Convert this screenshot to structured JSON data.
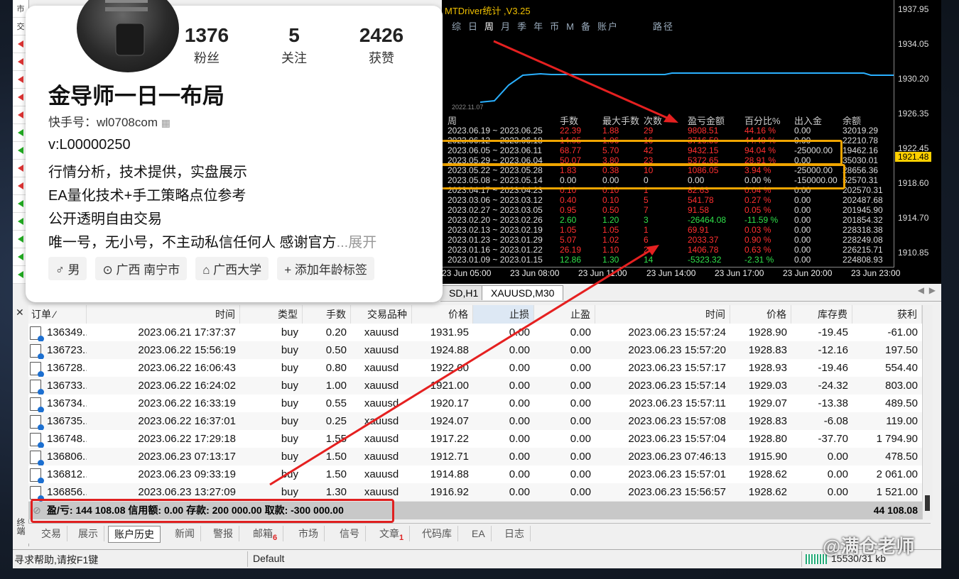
{
  "profile": {
    "followers": "1376",
    "followers_label": "粉丝",
    "following": "5",
    "following_label": "关注",
    "likes": "2426",
    "likes_label": "获赞",
    "name": "金导师一日一布局",
    "kuaishou_id": "快手号：wl0708com",
    "bio": [
      "v:L00000250",
      "行情分析，技术提供，实盘展示",
      "EA量化技术+手工策略点位参考",
      "公开透明自由交易"
    ],
    "bio_last": "唯一号，无小号，不主动私信任何人 感谢官方",
    "bio_more": "...展开",
    "tags": [
      "♂ 男",
      "⊙ 广西 南宁市",
      "⌂ 广西大学",
      "+ 添加年龄标签"
    ]
  },
  "left_strip": [
    "市",
    "交"
  ],
  "chart": {
    "title": "MTDriver统计 ,V3.25",
    "tabs": [
      "综",
      "日",
      "周",
      "月",
      "季",
      "年",
      "币",
      "M",
      "备",
      "账户",
      "路径"
    ],
    "active_tab": "周",
    "equity_date": "2022.11.07",
    "yticks": [
      "1937.95",
      "1934.05",
      "1930.20",
      "1926.35",
      "1922.45",
      "1918.60",
      "1914.70",
      "1910.85"
    ],
    "current_price": "1921.48",
    "xticks": [
      "23 Jun 05:00",
      "23 Jun 08:00",
      "23 Jun 11:00",
      "23 Jun 14:00",
      "23 Jun 17:00",
      "23 Jun 20:00",
      "23 Jun 23:00"
    ],
    "stat_headers": [
      "周",
      "手数",
      "最大手数",
      "次数",
      "盈亏金额",
      "百分比%",
      "出入金",
      "余额"
    ],
    "stat_rows": [
      [
        "2023.06.19 ~ 2023.06.25",
        "22.39",
        "1.88",
        "29",
        "9808.51",
        "44.16 %",
        "0.00",
        "32019.29",
        "r"
      ],
      [
        "2023.06.12 ~ 2023.06.18",
        "14.05",
        "1.06",
        "16",
        "3716.59",
        "44.49 %",
        "0.00",
        "22210.78",
        "r"
      ],
      [
        "2023.06.05 ~ 2023.06.11",
        "68.77",
        "5.70",
        "42",
        "9432.15",
        "94.04 %",
        "-25000.00",
        "19462.16",
        "r"
      ],
      [
        "2023.05.29 ~ 2023.06.04",
        "50.07",
        "3.80",
        "23",
        "5372.65",
        "28.91 %",
        "0.00",
        "35030.01",
        "r"
      ],
      [
        "2023.05.22 ~ 2023.05.28",
        "1.83",
        "0.38",
        "10",
        "1086.05",
        "3.94 %",
        "-25000.00",
        "28656.36",
        "r"
      ],
      [
        "2023.05.08 ~ 2023.05.14",
        "0.00",
        "0.00",
        "0",
        "0.00",
        "0.00 %",
        "-150000.00",
        "52570.31",
        "w"
      ],
      [
        "2023.04.17 ~ 2023.04.23",
        "0.10",
        "0.10",
        "1",
        "82.63",
        "0.04 %",
        "0.00",
        "202570.31",
        "r"
      ],
      [
        "2023.03.06 ~ 2023.03.12",
        "0.40",
        "0.10",
        "5",
        "541.78",
        "0.27 %",
        "0.00",
        "202487.68",
        "r"
      ],
      [
        "2023.02.27 ~ 2023.03.05",
        "0.95",
        "0.50",
        "7",
        "91.58",
        "0.05 %",
        "0.00",
        "201945.90",
        "r"
      ],
      [
        "2023.02.20 ~ 2023.02.26",
        "2.60",
        "1.20",
        "3",
        "-26464.08",
        "-11.59 %",
        "0.00",
        "201854.32",
        "g"
      ],
      [
        "2023.02.13 ~ 2023.02.19",
        "1.05",
        "1.05",
        "1",
        "69.91",
        "0.03 %",
        "0.00",
        "228318.38",
        "r"
      ],
      [
        "2023.01.23 ~ 2023.01.29",
        "5.07",
        "1.02",
        "6",
        "2033.37",
        "0.90 %",
        "0.00",
        "228249.08",
        "r"
      ],
      [
        "2023.01.16 ~ 2023.01.22",
        "26.19",
        "1.10",
        "27",
        "1406.78",
        "0.63 %",
        "0.00",
        "226215.71",
        "r"
      ],
      [
        "2023.01.09 ~ 2023.01.15",
        "12.86",
        "1.30",
        "14",
        "-5323.32",
        "-2.31 %",
        "0.00",
        "224808.93",
        "g"
      ]
    ]
  },
  "chart_tabs": [
    "SD,H1",
    "XAUUSD,M30"
  ],
  "table": {
    "headers": [
      "订单",
      "时间",
      "类型",
      "手数",
      "交易品种",
      "价格",
      "止损",
      "止盈",
      "时间",
      "价格",
      "库存费",
      "获利"
    ],
    "rows": [
      [
        "136349...",
        "2023.06.21 17:37:37",
        "buy",
        "0.20",
        "xauusd",
        "1931.95",
        "0.00",
        "0.00",
        "2023.06.23 15:57:24",
        "1928.90",
        "-19.45",
        "-61.00"
      ],
      [
        "136723...",
        "2023.06.22 15:56:19",
        "buy",
        "0.50",
        "xauusd",
        "1924.88",
        "0.00",
        "0.00",
        "2023.06.23 15:57:20",
        "1928.83",
        "-12.16",
        "197.50"
      ],
      [
        "136728...",
        "2023.06.22 16:06:43",
        "buy",
        "0.80",
        "xauusd",
        "1922.00",
        "0.00",
        "0.00",
        "2023.06.23 15:57:17",
        "1928.93",
        "-19.46",
        "554.40"
      ],
      [
        "136733...",
        "2023.06.22 16:24:02",
        "buy",
        "1.00",
        "xauusd",
        "1921.00",
        "0.00",
        "0.00",
        "2023.06.23 15:57:14",
        "1929.03",
        "-24.32",
        "803.00"
      ],
      [
        "136734...",
        "2023.06.22 16:33:19",
        "buy",
        "0.55",
        "xauusd",
        "1920.17",
        "0.00",
        "0.00",
        "2023.06.23 15:57:11",
        "1929.07",
        "-13.38",
        "489.50"
      ],
      [
        "136735...",
        "2023.06.22 16:37:01",
        "buy",
        "0.25",
        "xauusd",
        "1924.07",
        "0.00",
        "0.00",
        "2023.06.23 15:57:08",
        "1928.83",
        "-6.08",
        "119.00"
      ],
      [
        "136748...",
        "2023.06.22 17:29:18",
        "buy",
        "1.55",
        "xauusd",
        "1917.22",
        "0.00",
        "0.00",
        "2023.06.23 15:57:04",
        "1928.80",
        "-37.70",
        "1 794.90"
      ],
      [
        "136806...",
        "2023.06.23 07:13:17",
        "buy",
        "1.50",
        "xauusd",
        "1912.71",
        "0.00",
        "0.00",
        "2023.06.23 07:46:13",
        "1915.90",
        "0.00",
        "478.50"
      ],
      [
        "136812...",
        "2023.06.23 09:33:19",
        "buy",
        "1.50",
        "xauusd",
        "1914.88",
        "0.00",
        "0.00",
        "2023.06.23 15:57:01",
        "1928.62",
        "0.00",
        "2 061.00"
      ],
      [
        "136856...",
        "2023.06.23 13:27:09",
        "buy",
        "1.30",
        "xauusd",
        "1916.92",
        "0.00",
        "0.00",
        "2023.06.23 15:56:57",
        "1928.62",
        "0.00",
        "1 521.00"
      ]
    ],
    "summary": "盈/亏: 144 108.08  信用额: 0.00  存款: 200 000.00  取款: -300 000.00",
    "summary_total": "44 108.08"
  },
  "bottom_tabs": [
    {
      "label": "交易",
      "badge": ""
    },
    {
      "label": "展示",
      "badge": ""
    },
    {
      "label": "账户历史",
      "badge": ""
    },
    {
      "label": "新闻",
      "badge": ""
    },
    {
      "label": "警报",
      "badge": ""
    },
    {
      "label": "邮箱",
      "badge": "6"
    },
    {
      "label": "市场",
      "badge": ""
    },
    {
      "label": "信号",
      "badge": ""
    },
    {
      "label": "文章",
      "badge": "1"
    },
    {
      "label": "代码库",
      "badge": ""
    },
    {
      "label": "EA",
      "badge": ""
    },
    {
      "label": "日志",
      "badge": ""
    }
  ],
  "status": {
    "help": "寻求帮助,请按F1键",
    "profile": "Default",
    "traffic": "15530/31 kb"
  },
  "watermark": "@满仓老师"
}
